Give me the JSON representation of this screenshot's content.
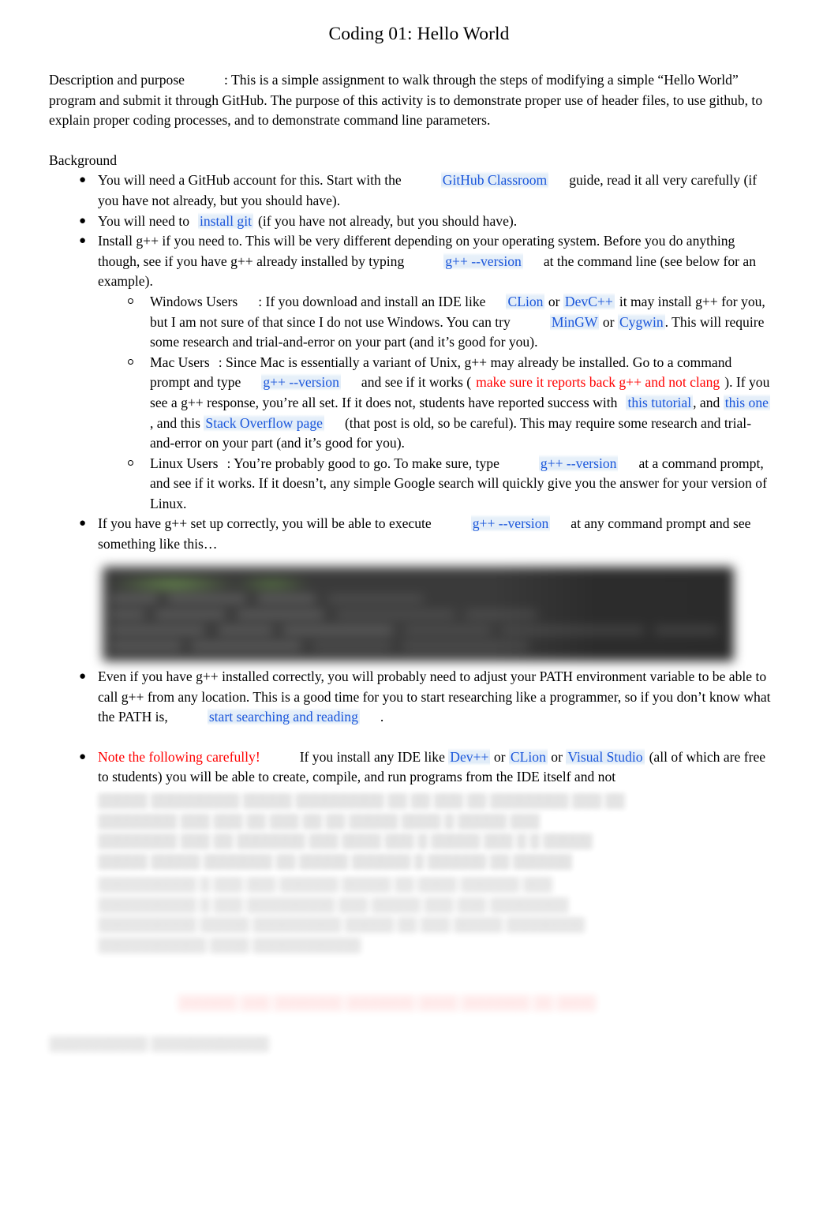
{
  "document": {
    "title": "Coding 01: Hello World"
  },
  "intro": {
    "label": "Description and purpose",
    "text": ": This is a simple assignment to walk through the steps of modifying a simple “Hello World” program and submit it through GitHub. The purpose of this activity is to demonstrate proper use of header files, to use github, to explain proper coding processes, and to demonstrate command line parameters."
  },
  "background": {
    "heading": "Background",
    "bullets": [
      {
        "id": "github-account",
        "parts": [
          {
            "type": "text",
            "value": "You will need a GitHub account for this. Start with the"
          },
          {
            "type": "gap-wide"
          },
          {
            "type": "link",
            "value": "GitHub Classroom"
          },
          {
            "type": "gap-med"
          },
          {
            "type": "text",
            "value": "guide, read it all very carefully (if you have not already, but you should have)."
          }
        ]
      },
      {
        "id": "install-git",
        "parts": [
          {
            "type": "text",
            "value": "You will need to"
          },
          {
            "type": "gap-sm"
          },
          {
            "type": "link",
            "value": "install git"
          },
          {
            "type": "gap-xs"
          },
          {
            "type": "text",
            "value": "(if you have not already, but you should have)."
          }
        ]
      },
      {
        "id": "install-gpp",
        "parts": [
          {
            "type": "text",
            "value": "Install  g++  if you need to. This will be very different depending on your operating system. Before you do anything though, see if you have g++ already installed by typing"
          },
          {
            "type": "gap-wide"
          },
          {
            "type": "code",
            "value": "g++ --version"
          },
          {
            "type": "gap-med"
          },
          {
            "type": "text",
            "value": "at the command line (see below for an example)."
          }
        ]
      }
    ],
    "sub_bullets": [
      {
        "id": "windows-users",
        "label": "Windows Users",
        "parts": [
          {
            "type": "text",
            "value": ": If you download and install an IDE like"
          },
          {
            "type": "gap-med"
          },
          {
            "type": "link",
            "value": "CLion"
          },
          {
            "type": "text",
            "value": " or "
          },
          {
            "type": "link",
            "value": "DevC++"
          },
          {
            "type": "gap-xs"
          },
          {
            "type": "text",
            "value": "it may install g++ for you, but I am not sure of that since I do not use Windows. You can try"
          },
          {
            "type": "gap-wide"
          },
          {
            "type": "link",
            "value": "MinGW"
          },
          {
            "type": "text",
            "value": " or "
          },
          {
            "type": "link",
            "value": "Cygwin"
          },
          {
            "type": "text",
            "value": ". This will require some research and trial-and-error on your part (and it’s good for you)."
          }
        ]
      },
      {
        "id": "mac-users",
        "label": "Mac Users",
        "parts": [
          {
            "type": "text",
            "value": ": Since Mac is essentially a variant of Unix, g++ may already be installed. Go to a command prompt and type"
          },
          {
            "type": "gap-med"
          },
          {
            "type": "code",
            "value": "g++ --version"
          },
          {
            "type": "gap-med"
          },
          {
            "type": "text",
            "value": "and see if it works ("
          },
          {
            "type": "gap-xs"
          },
          {
            "type": "red",
            "value": "make sure it reports back g++ and not clang"
          },
          {
            "type": "gap-xs"
          },
          {
            "type": "text",
            "value": "). If you see a g++ response, you’re all set. If it does not, students have reported success with"
          },
          {
            "type": "gap-sm"
          },
          {
            "type": "link",
            "value": "this tutorial"
          },
          {
            "type": "text",
            "value": ", and "
          },
          {
            "type": "link",
            "value": "this one"
          },
          {
            "type": "text",
            "value": " , and this "
          },
          {
            "type": "link",
            "value": "Stack Overflow page"
          },
          {
            "type": "gap-med"
          },
          {
            "type": "text",
            "value": "(that post is old, so be careful). This may require some research and trial-and-error on your part (and it’s good for you)."
          }
        ]
      },
      {
        "id": "linux-users",
        "label": "Linux Users",
        "parts": [
          {
            "type": "text",
            "value": ": You’re probably good to go. To make sure, type"
          },
          {
            "type": "gap-wide"
          },
          {
            "type": "code",
            "value": "g++ --version"
          },
          {
            "type": "gap-med"
          },
          {
            "type": "text",
            "value": "at a command prompt, and see if it works. If it doesn’t, any simple Google search will quickly give you the answer for your version of Linux."
          }
        ]
      }
    ],
    "bullets_after": [
      {
        "id": "execute-version",
        "parts": [
          {
            "type": "text",
            "value": "If you have g++ set up correctly, you will be able to execute"
          },
          {
            "type": "gap-wide"
          },
          {
            "type": "code",
            "value": "g++ --version"
          },
          {
            "type": "gap-med"
          },
          {
            "type": "text",
            "value": "at any command prompt and see something like this…"
          }
        ]
      }
    ],
    "bullets_after_image": [
      {
        "id": "path-environment",
        "parts": [
          {
            "type": "text",
            "value": "Even if you have g++ installed correctly, you will probably need to adjust your PATH environment variable to be able to call g++ from any location. This is a good time for you to start researching like a programmer, so if you don’t know what the PATH is,"
          },
          {
            "type": "gap-wide"
          },
          {
            "type": "link",
            "value": "start searching and reading"
          },
          {
            "type": "gap-med"
          },
          {
            "type": "text",
            "value": "."
          }
        ]
      },
      {
        "id": "note-carefully",
        "parts": [
          {
            "type": "red",
            "value": "Note the following carefully!"
          },
          {
            "type": "gap-wide"
          },
          {
            "type": "text",
            "value": "If you install any IDE like "
          },
          {
            "type": "link",
            "value": "Dev++"
          },
          {
            "type": "text",
            "value": " or "
          },
          {
            "type": "link",
            "value": "CLion"
          },
          {
            "type": "text",
            "value": " or "
          },
          {
            "type": "link",
            "value": "Visual Studio"
          },
          {
            "type": "gap-xs"
          },
          {
            "type": "text",
            "value": "(all of which are free to students) you will be able to create, compile, and run programs from the IDE itself and not"
          }
        ]
      }
    ]
  },
  "terminal_screenshot": {
    "alt": "blurred terminal screenshot showing g++ --version output",
    "prompt_color": "#6e9650",
    "background_color": "#303030"
  },
  "redacted": {
    "note": "Remaining document content is blurred and unreadable in the screenshot.",
    "paragraph_lines": [
      "░░░░░ ░░░░░░░░░ ░░░░░ ░░░░░░░░░  ░░ ░░ ░░░ ░░ ░░░░░░░░ ░░░ ░░",
      "░░░░░░░░ ░░░ ░░░ ░░ ░░░ ░░ ░░ ░░░░░ ░░░░ ░ ░░░░░ ░░░",
      "░░░░░░░░ ░░░ ░░ ░░░░░░░ ░░░  ░░░░ ░░░ ░ ░░░░░ ░░░ ░ ░ ░░░░░",
      "░░░░░ ░░░░░ ░░░░░░░ ░░ ░░░░░ ░░░░░░ ░ ░░░░░░ ░░ ░░░░░░",
      "░░░░░░░░░░ ░ ░░░ ░░░ ░░░░░░ ░░░░░ ░░ ░░░░ ░░░░░░ ░░░",
      "░░░░░░░░░░ ░ ░░░ ░░░░░░░░░ ░░░ ░░░░░ ░░░ ░░░ ░░░░░░░░",
      "░░░░░░░░░░ ░░░░░ ░░░░░░░░░ ░░░░░ ░░ ░░░ ░░░░░ ░░░░░░░░",
      "░░░░░░░░░░░ ░░░░ ░░░░░░░░░░░"
    ],
    "red_line": "░░░░░░ ░░░ ░░░░░░░ ░░░░░░░ ░░░░ ░░░░░░░ ░░ ░░░░",
    "heading_line": "░░░░░░░░░░  ░░░░░░░░░░░░"
  }
}
